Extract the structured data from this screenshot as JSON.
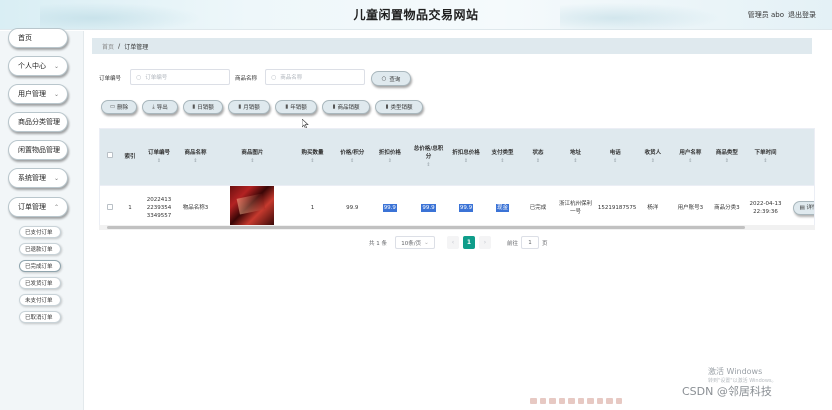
{
  "header": {
    "title": "儿童闲置物品交易网站",
    "user": "管理员 abo",
    "logout": "退出登录"
  },
  "sidebar": {
    "items": [
      {
        "label": "首页",
        "has_chevron": false
      },
      {
        "label": "个人中心",
        "has_chevron": true
      },
      {
        "label": "用户管理",
        "has_chevron": true
      },
      {
        "label": "商品分类管理",
        "has_chevron": true
      },
      {
        "label": "闲置物品管理",
        "has_chevron": true
      },
      {
        "label": "系统管理",
        "has_chevron": true
      },
      {
        "label": "订单管理",
        "has_chevron": true
      }
    ],
    "sub_items": [
      {
        "label": "已支付订单"
      },
      {
        "label": "已退款订单"
      },
      {
        "label": "已完成订单",
        "active": true
      },
      {
        "label": "已发货订单"
      },
      {
        "label": "未支付订单"
      },
      {
        "label": "已取消订单"
      }
    ]
  },
  "breadcrumb": {
    "home": "首页",
    "separator": "/",
    "current": "订单管理"
  },
  "search": {
    "order_no_label": "订单编号",
    "order_no_placeholder": "订单编号",
    "product_label": "商品名称",
    "product_placeholder": "商品名称",
    "query_button": "查询"
  },
  "actions": [
    {
      "label": "删除",
      "icon": "trash-icon"
    },
    {
      "label": "导出",
      "icon": "download-icon"
    },
    {
      "label": "日销额",
      "icon": "bar-chart-icon"
    },
    {
      "label": "月销额",
      "icon": "bar-chart-icon"
    },
    {
      "label": "年销额",
      "icon": "bar-chart-icon"
    },
    {
      "label": "商品销额",
      "icon": "bar-chart-icon"
    },
    {
      "label": "类型销额",
      "icon": "bar-chart-icon"
    }
  ],
  "table": {
    "columns": [
      "索引",
      "订单编号",
      "商品名称",
      "商品图片",
      "购买数量",
      "价格/积分",
      "折扣价格",
      "总价格/总积分",
      "折扣总价格",
      "支付类型",
      "状态",
      "地址",
      "电话",
      "收货人",
      "用户名称",
      "商品类型",
      "下单时间"
    ],
    "rows": [
      {
        "index": "1",
        "order_no": "20224132239354334955 7",
        "order_no_display": "2022413\n2239354\n3349557",
        "product_name": "物品名称3",
        "quantity": "1",
        "price": "99.9",
        "discount_price": "99.9",
        "total_price": "99.9",
        "discount_total": "99.9",
        "pay_type": "现金",
        "status": "已完成",
        "address": "浙江杭州保利一号",
        "phone": "15219187575",
        "receiver": "杨洋",
        "user_name": "用户账号3",
        "product_type": "商品分类3",
        "order_time": "2022-04-13 22:39:36",
        "detail_button": "详情"
      }
    ]
  },
  "pagination": {
    "total_text": "共 1 条",
    "page_size": "10条/页",
    "current_page": "1",
    "goto_label": "前往",
    "goto_value": "1",
    "page_suffix": "页"
  },
  "watermark": {
    "activate_title": "激活 Windows",
    "activate_sub": "转到\"设置\"以激活 Windows。",
    "csdn": "CSDN @邻居科技"
  },
  "colors": {
    "accent": "#dfe9ee",
    "page_active": "#0f9d8a",
    "highlight": "#3b73d6"
  }
}
